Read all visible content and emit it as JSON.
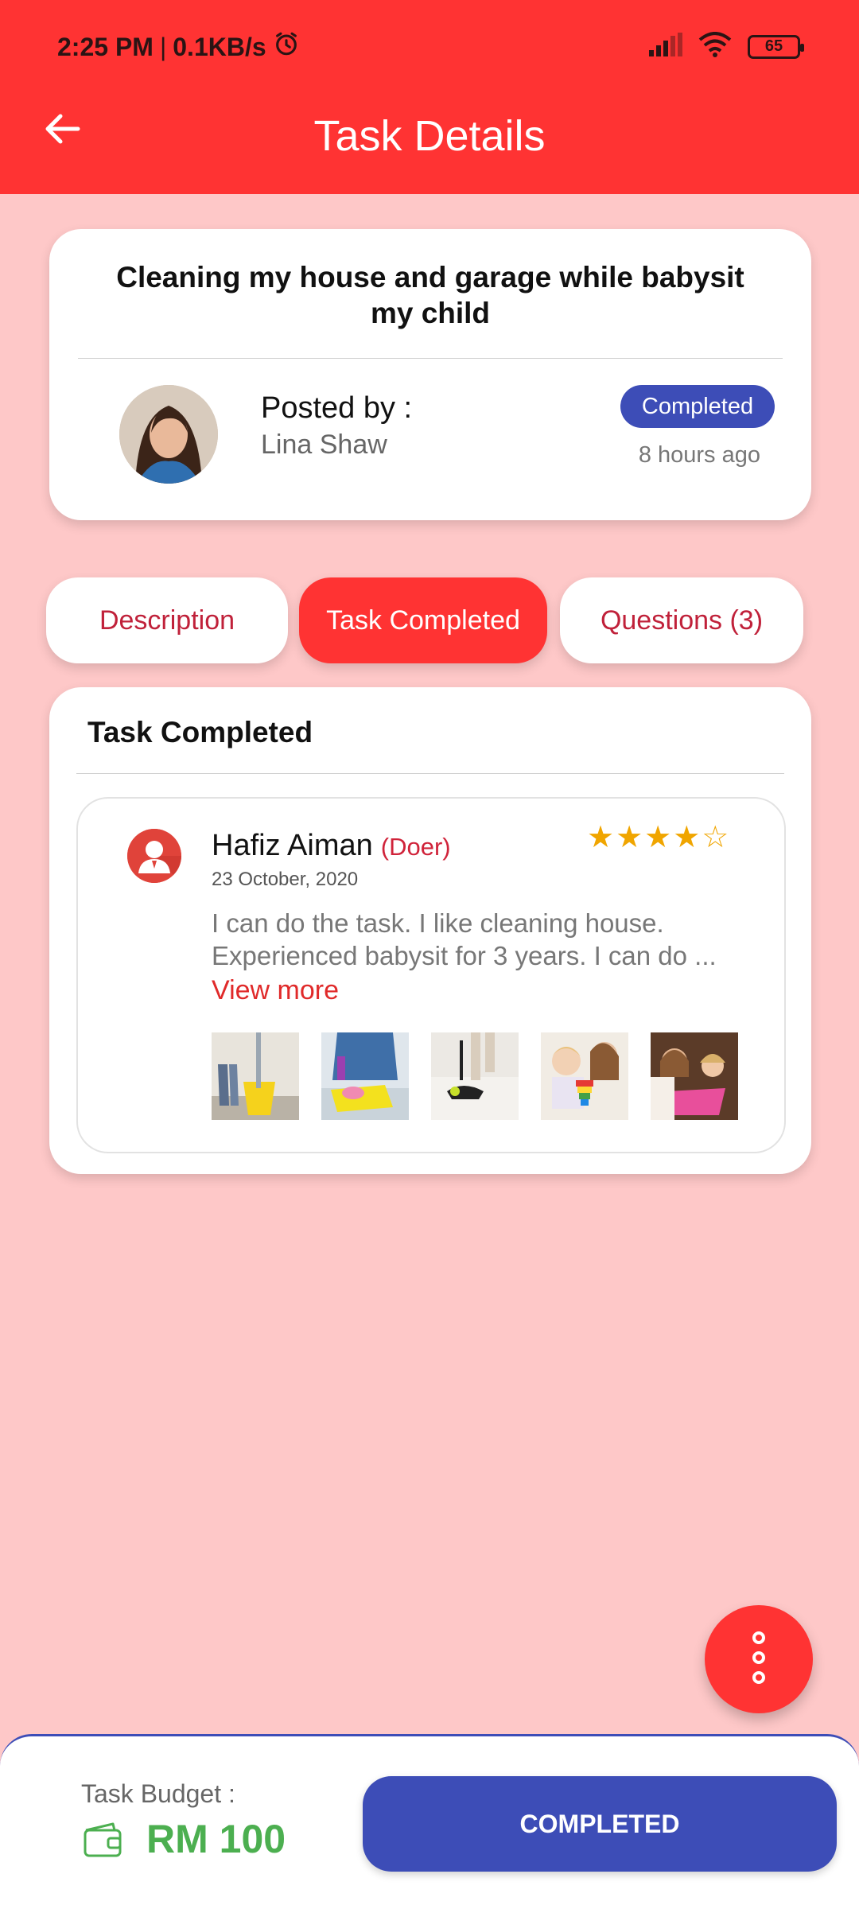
{
  "status_bar": {
    "time": "2:25 PM",
    "separator": "|",
    "speed": "0.1KB/s",
    "battery": "65"
  },
  "app_bar": {
    "title": "Task Details"
  },
  "task": {
    "title": "Cleaning my house and garage while babysit my child",
    "posted_by_label": "Posted by :",
    "poster_name": "Lina Shaw",
    "status": "Completed",
    "posted_ago": "8 hours ago"
  },
  "tabs": [
    {
      "label": "Description",
      "active": false
    },
    {
      "label": "Task Completed",
      "active": true
    },
    {
      "label": "Questions (3)",
      "active": false
    }
  ],
  "completed_section": {
    "title": "Task Completed",
    "doer_name": "Hafiz Aiman",
    "doer_role": "(Doer)",
    "date": "23 October, 2020",
    "stars": "★★★★☆",
    "rating": 4,
    "rating_max": 5,
    "description": "I can do the task. I like cleaning house. Experienced babysit for 3 years.  I can do ...",
    "view_more": "View more",
    "photo_icons": [
      "mop-bucket-photo",
      "cleaning-table-photo",
      "vacuum-photo",
      "toddler-toys-photo",
      "kids-playing-photo"
    ]
  },
  "footer": {
    "budget_label": "Task Budget :",
    "budget_value": "RM 100",
    "button_label": "COMPLETED"
  },
  "colors": {
    "primary_red": "#ff3333",
    "indigo": "#3d4db7",
    "green": "#4caf50",
    "background": "#fec8c8"
  }
}
